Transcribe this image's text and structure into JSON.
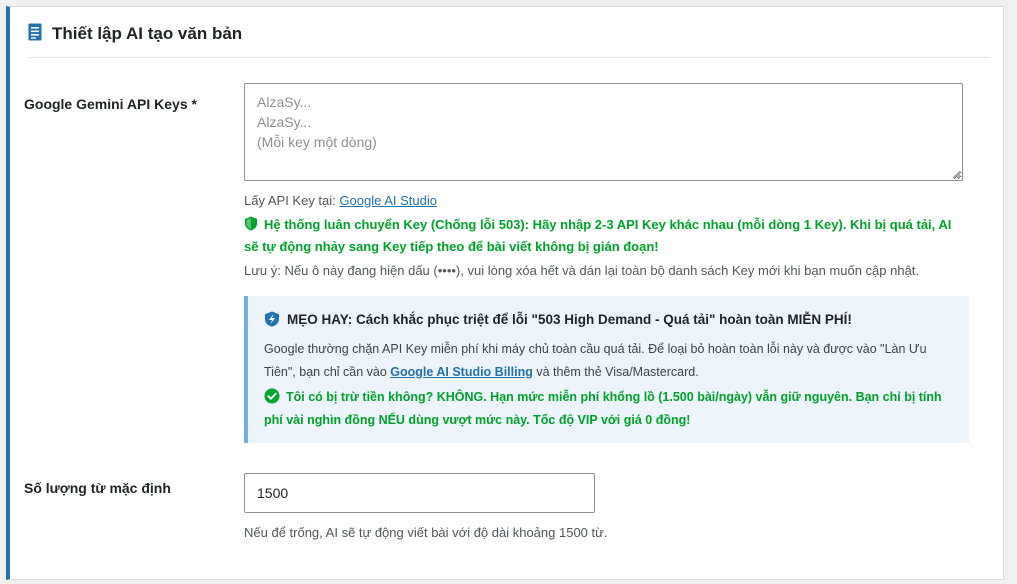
{
  "section": {
    "title": "Thiết lập AI tạo văn bản",
    "icon": "document-icon"
  },
  "api_keys": {
    "label": "Google Gemini API Keys *",
    "placeholder": "AlzaSy...\nAlzaSy...\n(Mỗi key một dòng)",
    "value": "",
    "get_key_prefix": "Lấy API Key tại: ",
    "get_key_link": "Google AI Studio",
    "rotation_notice": "Hệ thống luân chuyển Key (Chống lỗi 503): Hãy nhập 2-3 API Key khác nhau (mỗi dòng 1 Key). Khi bị quá tải, AI sẽ tự động nhảy sang Key tiếp theo để bài viết không bị gián đoạn!",
    "note": "Lưu ý: Nếu ô này đang hiện dấu (••••), vui lòng xóa hết và dán lại toàn bộ danh sách Key mới khi bạn muốn cập nhật."
  },
  "tip": {
    "title": "MẸO HAY: Cách khắc phục triệt để lỗi \"503 High Demand - Quá tải\" hoàn toàn MIỄN PHÍ!",
    "body_before": "Google thường chặn API Key miễn phí khi máy chủ toàn cầu quá tải. Để loại bỏ hoàn toàn lỗi này và được vào \"Làn Ưu Tiên\", bạn chỉ cần vào ",
    "body_link": "Google AI Studio Billing",
    "body_after": " và thêm thẻ Visa/Mastercard.",
    "green_text": "Tôi có bị trừ tiền không? KHÔNG. Hạn mức miễn phí khổng lồ (1.500 bài/ngày) vẫn giữ nguyên. Bạn chỉ bị tính phí vài nghìn đồng NẾU dùng vượt mức này. Tốc độ VIP với giá 0 đồng!"
  },
  "word_count": {
    "label": "Số lượng từ mặc định",
    "value": "1500",
    "help": "Nếu để trống, AI sẽ tự động viết bài với độ dài khoảng 1500 từ."
  },
  "colors": {
    "accent": "#2271b1",
    "green": "#00a32a",
    "tip_bg": "#eef4fb",
    "tip_border": "#72aee6"
  }
}
